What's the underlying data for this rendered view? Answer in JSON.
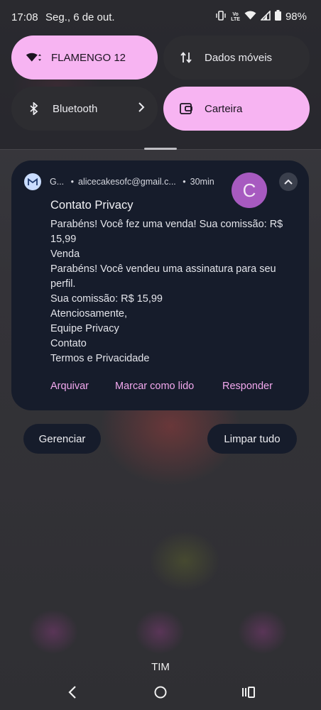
{
  "status_bar": {
    "time": "17:08",
    "date": "Seg., 6 de out.",
    "volte_label_top": "Vo",
    "volte_label_bottom": "LTE",
    "battery": "98%"
  },
  "quick_settings": {
    "wifi": {
      "label": "FLAMENGO 12",
      "icon": "wifi-icon",
      "state": "on"
    },
    "mobile_data": {
      "label": "Dados móveis",
      "icon": "data-arrows-icon",
      "state": "off"
    },
    "bluetooth": {
      "label": "Bluetooth",
      "icon": "bluetooth-icon",
      "state": "off"
    },
    "wallet": {
      "label": "Carteira",
      "icon": "wallet-icon",
      "state": "on"
    }
  },
  "notification": {
    "app_name": "G...",
    "account": "alicecakesofc@gmail.c...",
    "time": "30min",
    "avatar_letter": "C",
    "title": "Contato Privacy",
    "body_lines": [
      "Parabéns! Você fez uma venda! Sua comissão: R$",
      "15,99",
      "Venda",
      "Parabéns! Você vendeu uma assinatura para seu",
      "perfil.",
      "Sua comissão: R$ 15,99",
      "Atenciosamente,",
      "Equipe Privacy",
      "Contato",
      "Termos e Privacidade"
    ],
    "actions": {
      "archive": "Arquivar",
      "mark_read": "Marcar como lido",
      "reply": "Responder"
    }
  },
  "buttons": {
    "manage": "Gerenciar",
    "clear_all": "Limpar tudo"
  },
  "carrier": "TIM",
  "colors": {
    "tile_on": "#f7b4f2",
    "tile_off": "#2d2d31",
    "card_bg": "#161c2b",
    "action_text": "#f2a8ee",
    "avatar_bg": "#a75ac0"
  }
}
